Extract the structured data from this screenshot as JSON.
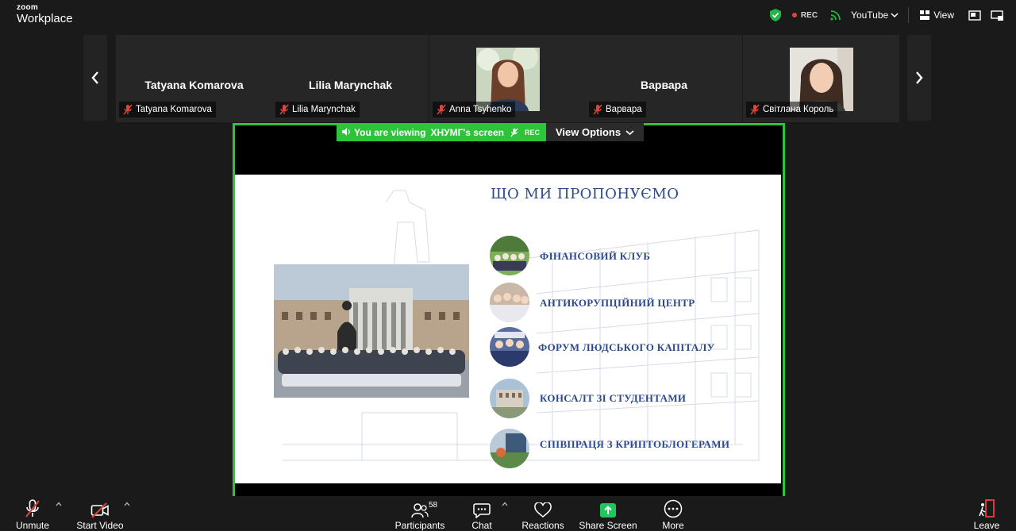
{
  "app": {
    "brand_top": "zoom",
    "brand_bottom": "Workplace"
  },
  "topbar": {
    "rec_label": "REC",
    "stream_label": "YouTube",
    "view_label": "View"
  },
  "participants": [
    {
      "big_name": "Tatyana Komarova",
      "label": "Tatyana Komarova"
    },
    {
      "big_name": "Lilia Marynchak",
      "label": "Lilia Marynchak"
    },
    {
      "big_name": "",
      "label": "Anna Tsyhenko"
    },
    {
      "big_name": "Варвара",
      "label": "Варвара"
    },
    {
      "big_name": "",
      "label": "Світлана Король"
    }
  ],
  "share": {
    "viewing_prefix": "You are viewing",
    "presenter": "ХНУМГ's screen",
    "rec_label": "REC",
    "view_options": "View Options"
  },
  "slide": {
    "title": "ЩО МИ ПРОПОНУЄМО",
    "items": [
      {
        "text": "ФІНАНСОВИЙ КЛУБ"
      },
      {
        "text": "АНТИКОРУПЦІЙНИЙ ЦЕНТР"
      },
      {
        "text": "ФОРУМ ЛЮДСЬКОГО КАПІТАЛУ"
      },
      {
        "text": "КОНСАЛТ ЗІ СТУДЕНТАМИ"
      },
      {
        "text": "СПІВПРАЦЯ З КРИПТОБЛОГЕРАМИ"
      }
    ]
  },
  "toolbar": {
    "unmute": "Unmute",
    "start_video": "Start Video",
    "participants": "Participants",
    "participants_count": "58",
    "chat": "Chat",
    "reactions": "Reactions",
    "share_screen": "Share Screen",
    "more": "More",
    "leave": "Leave"
  },
  "colors": {
    "share_green": "#2ec43a",
    "slide_blue": "#2b4a8a",
    "leave_red": "#e0443a"
  }
}
